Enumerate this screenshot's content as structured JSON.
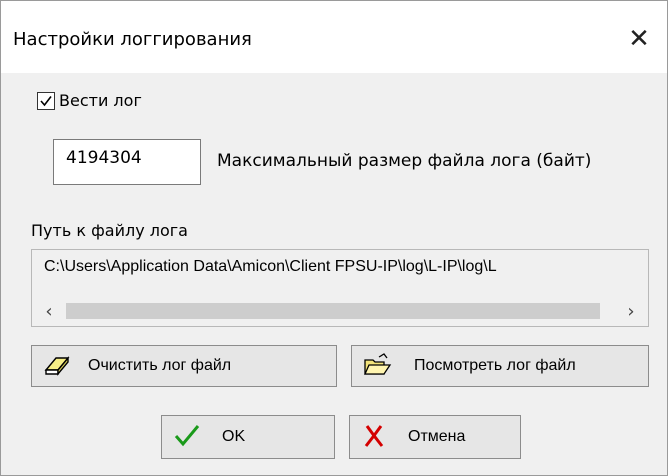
{
  "window": {
    "title": "Настройки логгирования",
    "close_glyph": "✕"
  },
  "logging": {
    "enabled_label": "Вести лог",
    "enabled": true,
    "max_size_value": "4194304",
    "max_size_label": "Максимальный размер файла лога (байт)",
    "path_label": "Путь к файлу лога",
    "path_value": "C:\\Users\\Application Data\\Amicon\\Client FPSU-IP\\log\\L-IP\\log\\L"
  },
  "scrollbar": {
    "left_glyph": "‹",
    "right_glyph": "›"
  },
  "buttons": {
    "clear_label": "Очистить лог файл",
    "clear_icon": "eraser-icon",
    "view_label": "Посмотреть лог файл",
    "view_icon": "open-folder-icon",
    "ok_label": "OK",
    "ok_icon": "checkmark-icon",
    "cancel_label": "Отмена",
    "cancel_icon": "red-x-icon"
  },
  "colors": {
    "ok_check": "#1a9a1a",
    "cancel_x": "#d40000"
  }
}
